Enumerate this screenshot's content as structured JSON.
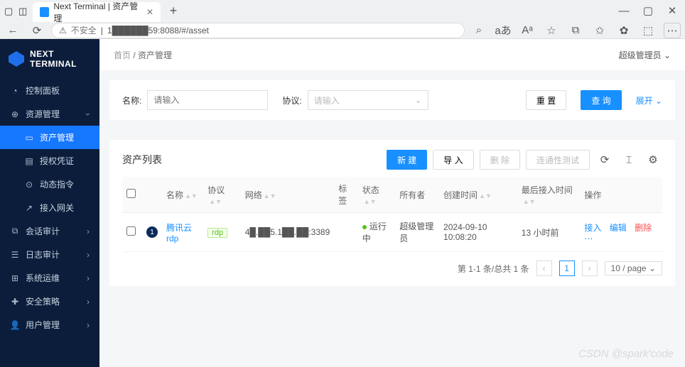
{
  "browser": {
    "tab_title": "Next Terminal | 资产管理",
    "url_insecure": "不安全",
    "url": "1██████59:8088/#/asset"
  },
  "logo": {
    "line1": "NEXT",
    "line2": "TERMINAL"
  },
  "sidebar": {
    "items": [
      {
        "icon": "◔",
        "label": "控制面板"
      },
      {
        "icon": "⊕",
        "label": "资源管理"
      },
      {
        "icon": "▭",
        "label": "资产管理",
        "sub": true,
        "active": true
      },
      {
        "icon": "▤",
        "label": "授权凭证",
        "sub": true
      },
      {
        "icon": "⊙",
        "label": "动态指令",
        "sub": true
      },
      {
        "icon": "↗",
        "label": "接入网关",
        "sub": true
      },
      {
        "icon": "⧉",
        "label": "会话审计"
      },
      {
        "icon": "☰",
        "label": "日志审计"
      },
      {
        "icon": "⊞",
        "label": "系统运维"
      },
      {
        "icon": "✚",
        "label": "安全策略"
      },
      {
        "icon": "👤",
        "label": "用户管理"
      }
    ]
  },
  "header": {
    "breadcrumb_home": "首页",
    "breadcrumb_current": "资产管理",
    "user": "超级管理员"
  },
  "filter": {
    "name_label": "名称:",
    "name_placeholder": "请输入",
    "protocol_label": "协议:",
    "protocol_placeholder": "请输入",
    "reset": "重 置",
    "search": "查 询",
    "expand": "展开"
  },
  "list": {
    "title": "资产列表",
    "new": "新 建",
    "import": "导 入",
    "delete": "删 除",
    "conn_test": "连通性测试",
    "cols": {
      "name": "名称",
      "protocol": "协议",
      "network": "网络",
      "tag": "标签",
      "status": "状态",
      "owner": "所有者",
      "created": "创建时间",
      "last": "最后接入时间",
      "ops": "操作"
    },
    "rows": [
      {
        "idx": "1",
        "name": "腾讯云rdp",
        "protocol": "rdp",
        "network": "4█.██5.1██.██:3389",
        "status": "运行中",
        "owner": "超级管理员",
        "created": "2024-09-10 10:08:20",
        "last": "13 小时前",
        "op_access": "接入",
        "op_edit": "编辑",
        "op_delete": "删除"
      }
    ],
    "pager": {
      "summary": "第 1-1 条/总共 1 条",
      "page": "1",
      "size": "10 / page"
    }
  },
  "watermark": "CSDN @spark'code"
}
